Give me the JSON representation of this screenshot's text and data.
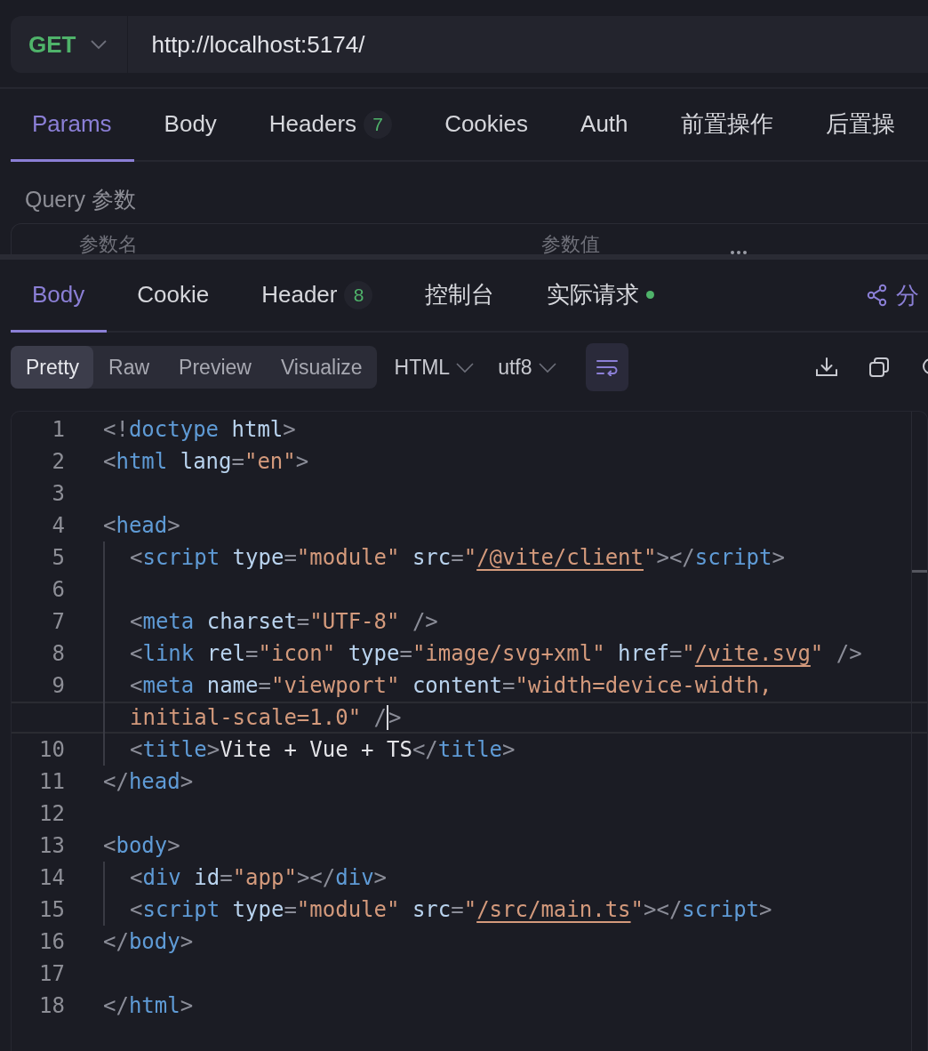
{
  "request": {
    "method": "GET",
    "url": "http://localhost:5174/"
  },
  "request_tabs": [
    {
      "label": "Params",
      "selected": true
    },
    {
      "label": "Body",
      "selected": false
    },
    {
      "label": "Headers",
      "badge": "7",
      "selected": false
    },
    {
      "label": "Cookies",
      "selected": false
    },
    {
      "label": "Auth",
      "selected": false
    },
    {
      "label": "前置操作",
      "selected": false
    },
    {
      "label": "后置操",
      "selected": false
    }
  ],
  "query": {
    "title": "Query 参数",
    "columns": [
      "参数名",
      "参数值"
    ]
  },
  "response_tabs": [
    {
      "label": "Body",
      "selected": true
    },
    {
      "label": "Cookie",
      "selected": false
    },
    {
      "label": "Header",
      "badge": "8",
      "selected": false
    },
    {
      "label": "控制台",
      "selected": false
    },
    {
      "label": "实际请求",
      "dot": true,
      "selected": false
    }
  ],
  "share": {
    "label": "分"
  },
  "view_modes": [
    {
      "label": "Pretty",
      "selected": true
    },
    {
      "label": "Raw",
      "selected": false
    },
    {
      "label": "Preview",
      "selected": false
    },
    {
      "label": "Visualize",
      "selected": false
    }
  ],
  "format": "HTML",
  "encoding": "utf8",
  "word_wrap": true,
  "code_lines": [
    {
      "number": "1",
      "indented": false,
      "tokens": [
        {
          "kind": "punct",
          "v": "<!"
        },
        {
          "kind": "tag",
          "v": "doctype"
        },
        {
          "kind": "attr",
          "v": " html"
        },
        {
          "kind": "punct",
          "v": ">"
        }
      ]
    },
    {
      "number": "2",
      "indented": false,
      "tokens": [
        {
          "kind": "punct",
          "v": "<"
        },
        {
          "kind": "tag",
          "v": "html"
        },
        {
          "kind": "attr",
          "v": " lang"
        },
        {
          "kind": "punct",
          "v": "="
        },
        {
          "kind": "string",
          "v": "\"en\""
        },
        {
          "kind": "punct",
          "v": ">"
        }
      ]
    },
    {
      "number": "3",
      "indented": false
    },
    {
      "number": "4",
      "indented": false,
      "tokens": [
        {
          "kind": "punct",
          "v": "<"
        },
        {
          "kind": "tag",
          "v": "head"
        },
        {
          "kind": "punct",
          "v": ">"
        }
      ]
    },
    {
      "number": "5",
      "indented": true,
      "tokens": [
        {
          "kind": "punct",
          "v": "<"
        },
        {
          "kind": "tag",
          "v": "script"
        },
        {
          "kind": "attr",
          "v": " type"
        },
        {
          "kind": "punct",
          "v": "="
        },
        {
          "kind": "string",
          "v": "\"module\""
        },
        {
          "kind": "attr",
          "v": " src"
        },
        {
          "kind": "punct",
          "v": "="
        },
        {
          "kind": "string",
          "v": "\""
        },
        {
          "kind": "link",
          "v": "/@vite/client"
        },
        {
          "kind": "string",
          "v": "\""
        },
        {
          "kind": "punct",
          "v": "></"
        },
        {
          "kind": "tag",
          "v": "script"
        },
        {
          "kind": "punct",
          "v": ">"
        }
      ]
    },
    {
      "number": "6",
      "indented": true
    },
    {
      "number": "7",
      "indented": true,
      "tokens": [
        {
          "kind": "punct",
          "v": "<"
        },
        {
          "kind": "tag",
          "v": "meta"
        },
        {
          "kind": "attr",
          "v": " charset"
        },
        {
          "kind": "punct",
          "v": "="
        },
        {
          "kind": "string",
          "v": "\"UTF-8\""
        },
        {
          "kind": "punct",
          "v": " />"
        }
      ]
    },
    {
      "number": "8",
      "indented": true,
      "tokens": [
        {
          "kind": "punct",
          "v": "<"
        },
        {
          "kind": "tag",
          "v": "link"
        },
        {
          "kind": "attr",
          "v": " rel"
        },
        {
          "kind": "punct",
          "v": "="
        },
        {
          "kind": "string",
          "v": "\"icon\""
        },
        {
          "kind": "attr",
          "v": " type"
        },
        {
          "kind": "punct",
          "v": "="
        },
        {
          "kind": "string",
          "v": "\"image/svg+xml\""
        },
        {
          "kind": "attr",
          "v": " href"
        },
        {
          "kind": "punct",
          "v": "="
        },
        {
          "kind": "string",
          "v": "\""
        },
        {
          "kind": "link",
          "v": "/vite.svg"
        },
        {
          "kind": "string",
          "v": "\""
        },
        {
          "kind": "punct",
          "v": " />"
        }
      ]
    },
    {
      "number": "9",
      "indented": true,
      "tokens": [
        {
          "kind": "punct",
          "v": "<"
        },
        {
          "kind": "tag",
          "v": "meta"
        },
        {
          "kind": "attr",
          "v": " name"
        },
        {
          "kind": "punct",
          "v": "="
        },
        {
          "kind": "string",
          "v": "\"viewport\""
        },
        {
          "kind": "attr",
          "v": " content"
        },
        {
          "kind": "punct",
          "v": "="
        },
        {
          "kind": "string",
          "v": "\"width=device-width,"
        }
      ]
    },
    {
      "indented": true,
      "current": true,
      "tokens": [
        {
          "kind": "string",
          "v": "initial-scale=1.0\""
        },
        {
          "kind": "punct",
          "v": " /"
        },
        {
          "kind": "cursor"
        },
        {
          "kind": "punct",
          "v": ">"
        }
      ]
    },
    {
      "number": "10",
      "indented": true,
      "tokens": [
        {
          "kind": "punct",
          "v": "<"
        },
        {
          "kind": "tag",
          "v": "title"
        },
        {
          "kind": "punct",
          "v": ">"
        },
        {
          "kind": "text",
          "v": "Vite + Vue + TS"
        },
        {
          "kind": "punct",
          "v": "</"
        },
        {
          "kind": "tag",
          "v": "title"
        },
        {
          "kind": "punct",
          "v": ">"
        }
      ]
    },
    {
      "number": "11",
      "indented": false,
      "tokens": [
        {
          "kind": "punct",
          "v": "</"
        },
        {
          "kind": "tag",
          "v": "head"
        },
        {
          "kind": "punct",
          "v": ">"
        }
      ]
    },
    {
      "number": "12",
      "indented": false
    },
    {
      "number": "13",
      "indented": false,
      "tokens": [
        {
          "kind": "punct",
          "v": "<"
        },
        {
          "kind": "tag",
          "v": "body"
        },
        {
          "kind": "punct",
          "v": ">"
        }
      ]
    },
    {
      "number": "14",
      "indented": true,
      "tokens": [
        {
          "kind": "punct",
          "v": "<"
        },
        {
          "kind": "tag",
          "v": "div"
        },
        {
          "kind": "attr",
          "v": " id"
        },
        {
          "kind": "punct",
          "v": "="
        },
        {
          "kind": "string",
          "v": "\"app\""
        },
        {
          "kind": "punct",
          "v": "></"
        },
        {
          "kind": "tag",
          "v": "div"
        },
        {
          "kind": "punct",
          "v": ">"
        }
      ]
    },
    {
      "number": "15",
      "indented": true,
      "tokens": [
        {
          "kind": "punct",
          "v": "<"
        },
        {
          "kind": "tag",
          "v": "script"
        },
        {
          "kind": "attr",
          "v": " type"
        },
        {
          "kind": "punct",
          "v": "="
        },
        {
          "kind": "string",
          "v": "\"module\""
        },
        {
          "kind": "attr",
          "v": " src"
        },
        {
          "kind": "punct",
          "v": "="
        },
        {
          "kind": "string",
          "v": "\""
        },
        {
          "kind": "link",
          "v": "/src/main.ts"
        },
        {
          "kind": "string",
          "v": "\""
        },
        {
          "kind": "punct",
          "v": "></"
        },
        {
          "kind": "tag",
          "v": "script"
        },
        {
          "kind": "punct",
          "v": ">"
        }
      ]
    },
    {
      "number": "16",
      "indented": false,
      "tokens": [
        {
          "kind": "punct",
          "v": "</"
        },
        {
          "kind": "tag",
          "v": "body"
        },
        {
          "kind": "punct",
          "v": ">"
        }
      ]
    },
    {
      "number": "17",
      "indented": false
    },
    {
      "number": "18",
      "indented": false,
      "tokens": [
        {
          "kind": "punct",
          "v": "</"
        },
        {
          "kind": "tag",
          "v": "html"
        },
        {
          "kind": "punct",
          "v": ">"
        }
      ]
    }
  ]
}
